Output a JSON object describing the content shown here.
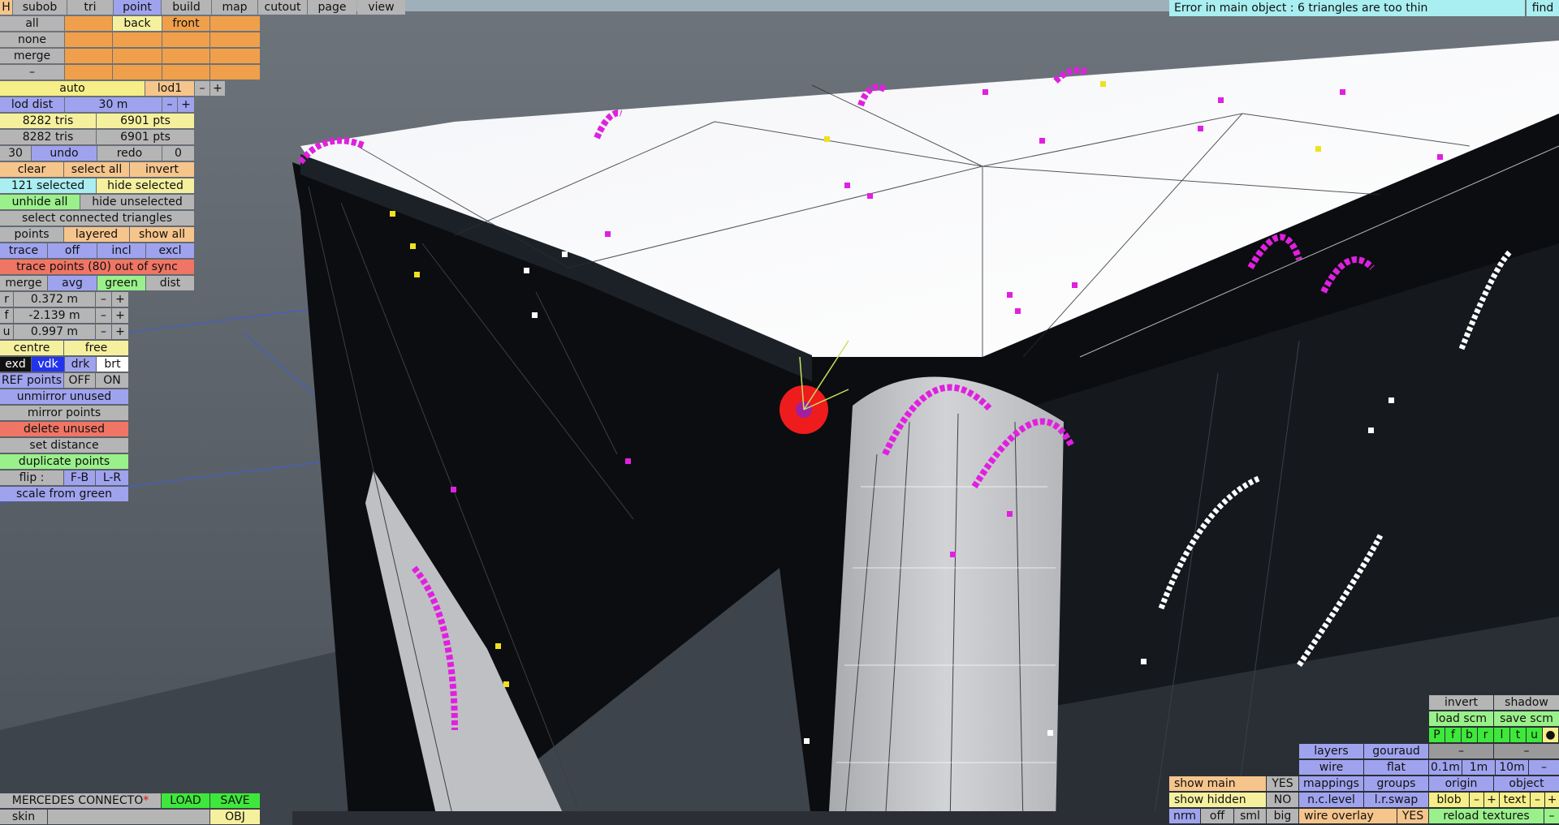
{
  "menu": {
    "h": "H",
    "tabs": [
      "subob",
      "tri",
      "point",
      "build",
      "map",
      "cutout",
      "page",
      "view"
    ],
    "active_tab": "point"
  },
  "error_text": "Error in main object : 6 triangles are too thin",
  "find_label": "find",
  "layers": {
    "all": "all",
    "none": "none",
    "merge": "merge",
    "dash": "–",
    "back": "back",
    "front": "front"
  },
  "lod": {
    "auto": "auto",
    "lod1": "lod1",
    "minus": "–",
    "plus": "+",
    "lod_dist_label": "lod dist",
    "lod_dist_value": "30 m"
  },
  "stats": {
    "tris_a": "8282 tris",
    "pts_a": "6901 pts",
    "tris_b": "8282 tris",
    "pts_b": "6901 pts"
  },
  "history": {
    "count": "30",
    "undo": "undo",
    "redo": "redo",
    "redo_count": "0"
  },
  "selection": {
    "clear": "clear",
    "select_all": "select all",
    "invert": "invert",
    "selected": "121 selected",
    "hide_selected": "hide selected",
    "unhide_all": "unhide all",
    "hide_unselected": "hide unselected",
    "select_connected": "select connected triangles"
  },
  "points_row": {
    "points": "points",
    "layered": "layered",
    "show_all": "show all"
  },
  "trace_row": {
    "trace": "trace",
    "off": "off",
    "incl": "incl",
    "excl": "excl",
    "warning": "trace points (80) out of sync"
  },
  "merge_row": {
    "merge": "merge",
    "avg": "avg",
    "green": "green",
    "dist": "dist"
  },
  "coords": {
    "r_label": "r",
    "r_value": "0.372 m",
    "f_label": "f",
    "f_value": "-2.139 m",
    "u_label": "u",
    "u_value": "0.997 m",
    "minus": "–",
    "plus": "+"
  },
  "tools": {
    "centre": "centre",
    "free": "free",
    "exd": "exd",
    "vdk": "vdk",
    "drk": "drk",
    "brt": "brt",
    "ref_points": "REF points",
    "off": "OFF",
    "on": "ON",
    "unmirror_unused": "unmirror unused",
    "mirror_points": "mirror points",
    "delete_unused": "delete unused",
    "set_distance": "set distance",
    "duplicate_points": "duplicate points",
    "flip": "flip :",
    "fb": "F-B",
    "lr": "L-R",
    "scale_from_green": "scale from green"
  },
  "file": {
    "name": "MERCEDES CONNECTO",
    "modified_mark": "*",
    "load": "LOAD",
    "save": "SAVE",
    "skin": "skin",
    "obj": "OBJ"
  },
  "view_panel": {
    "show_main": "show main",
    "show_main_val": "YES",
    "show_hidden": "show hidden",
    "show_hidden_val": "NO",
    "nrm": "nrm",
    "off": "off",
    "sml": "sml",
    "big": "big",
    "layers": "layers",
    "gouraud": "gouraud",
    "wire": "wire",
    "flat": "flat",
    "mappings": "mappings",
    "groups": "groups",
    "nc_level": "n.c.level",
    "lr_swap": "l.r.swap",
    "wire_overlay": "wire overlay",
    "wire_overlay_val": "YES",
    "invert": "invert",
    "shadow": "shadow",
    "load_scm": "load scm",
    "save_scm": "save scm",
    "letters": [
      "P",
      "f",
      "b",
      "r",
      "l",
      "t",
      "u",
      "●"
    ],
    "dash": "–",
    "d01": "0.1m",
    "d1": "1m",
    "d10": "10m",
    "origin": "origin",
    "object": "object",
    "blob": "blob",
    "text": "text",
    "plus": "+",
    "reload_textures": "reload textures"
  }
}
